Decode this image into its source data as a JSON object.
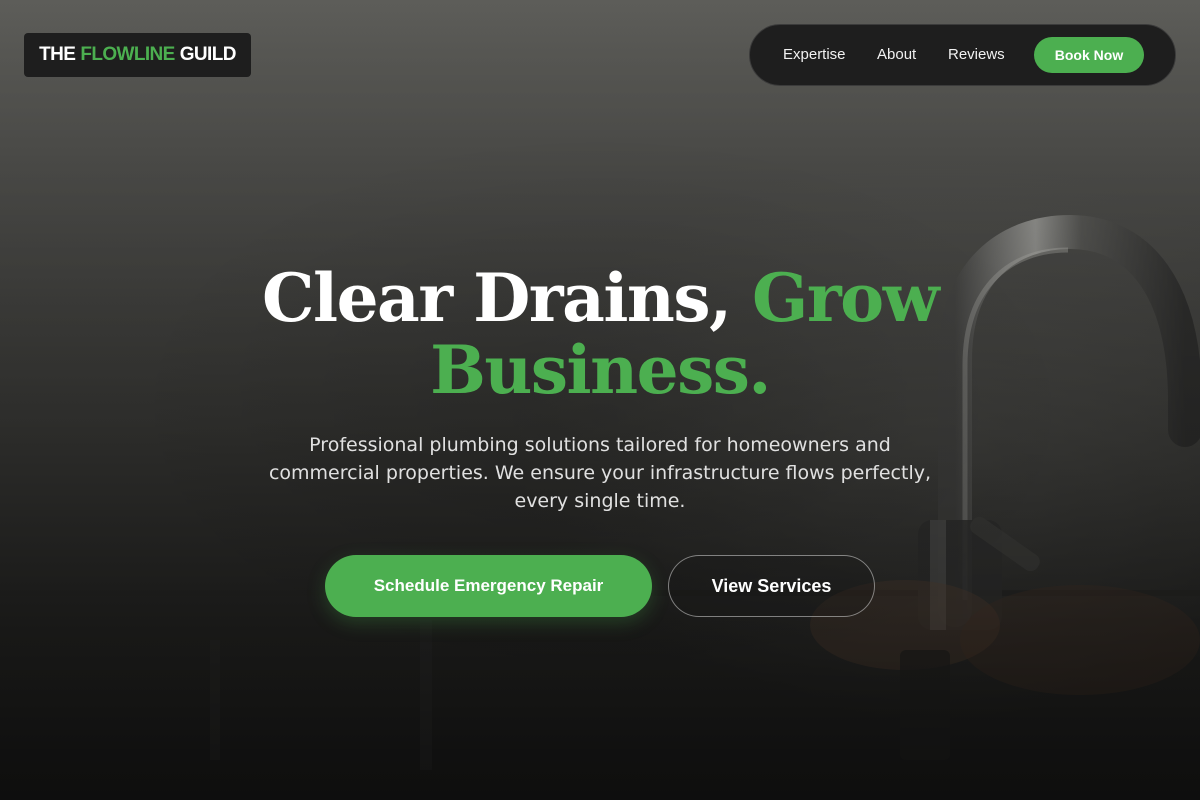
{
  "brand": {
    "name_prefix": "THE",
    "name_accent": "FLOWLINE",
    "name_suffix": "GUILD"
  },
  "nav": {
    "links": [
      {
        "label": "Expertise"
      },
      {
        "label": "About"
      },
      {
        "label": "Reviews"
      }
    ],
    "cta_label": "Book Now"
  },
  "hero": {
    "headline_white": "Clear Drains,",
    "headline_green_1": "Grow",
    "headline_green_2": "Business.",
    "subtitle": "Professional plumbing solutions tailored for homeowners and commercial properties. We ensure your infrastructure flows perfectly, every single time.",
    "primary_cta": "Schedule Emergency Repair",
    "secondary_cta": "View Services",
    "background_image": "kitchen-faucet-photo"
  },
  "colors": {
    "accent": "#4caf50",
    "panel": "#1e1e1e",
    "text": "#ffffff"
  }
}
